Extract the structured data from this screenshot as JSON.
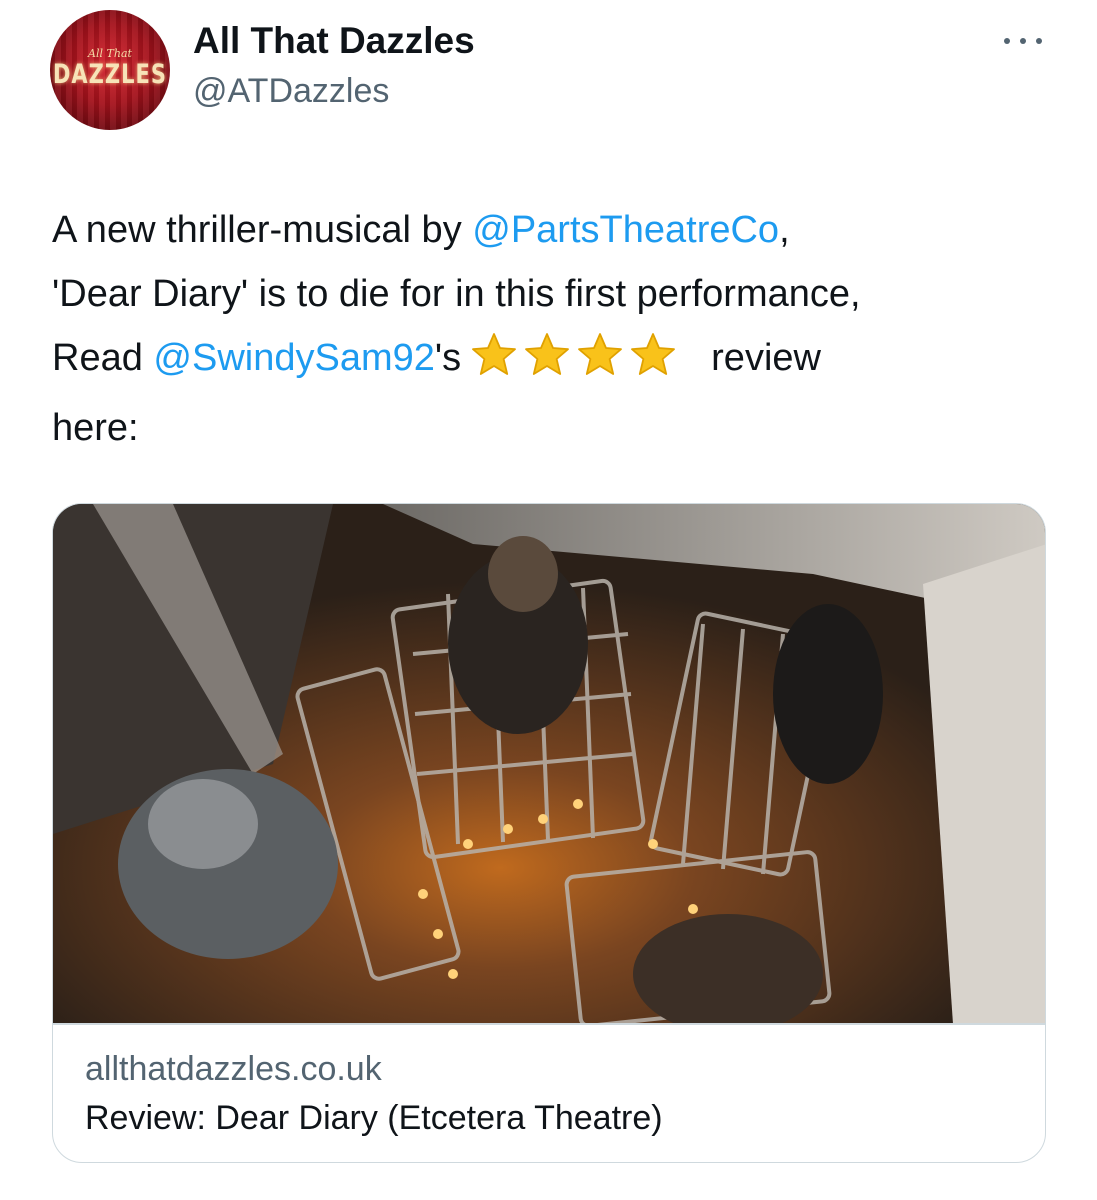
{
  "author": {
    "avatar": {
      "small_text": "All That",
      "big_text": "DAZZLES"
    },
    "display_name": "All That Dazzles",
    "handle": "@ATDazzles"
  },
  "menu": {
    "icon": "more-horizontal-icon"
  },
  "tweet": {
    "line1": {
      "prefix": "A new thriller-musical by ",
      "mention": "@PartsTheatreCo",
      "suffix": ","
    },
    "line2": "'Dear Diary' is to die for in this first performance,",
    "line3": {
      "prefix": "Read ",
      "mention": "@SwindySam92",
      "suffix": "'s",
      "stars_count": 4,
      "after_stars": "review"
    },
    "line4": "here:"
  },
  "colors": {
    "mention": "#1d9bf0",
    "secondary_text": "#536471",
    "primary_text": "#0f1419",
    "border": "#cfd9de",
    "star": "#f9c21a"
  },
  "link_card": {
    "domain": "allthatdazzles.co.uk",
    "title": "Review: Dear Diary (Etcetera Theatre)"
  }
}
